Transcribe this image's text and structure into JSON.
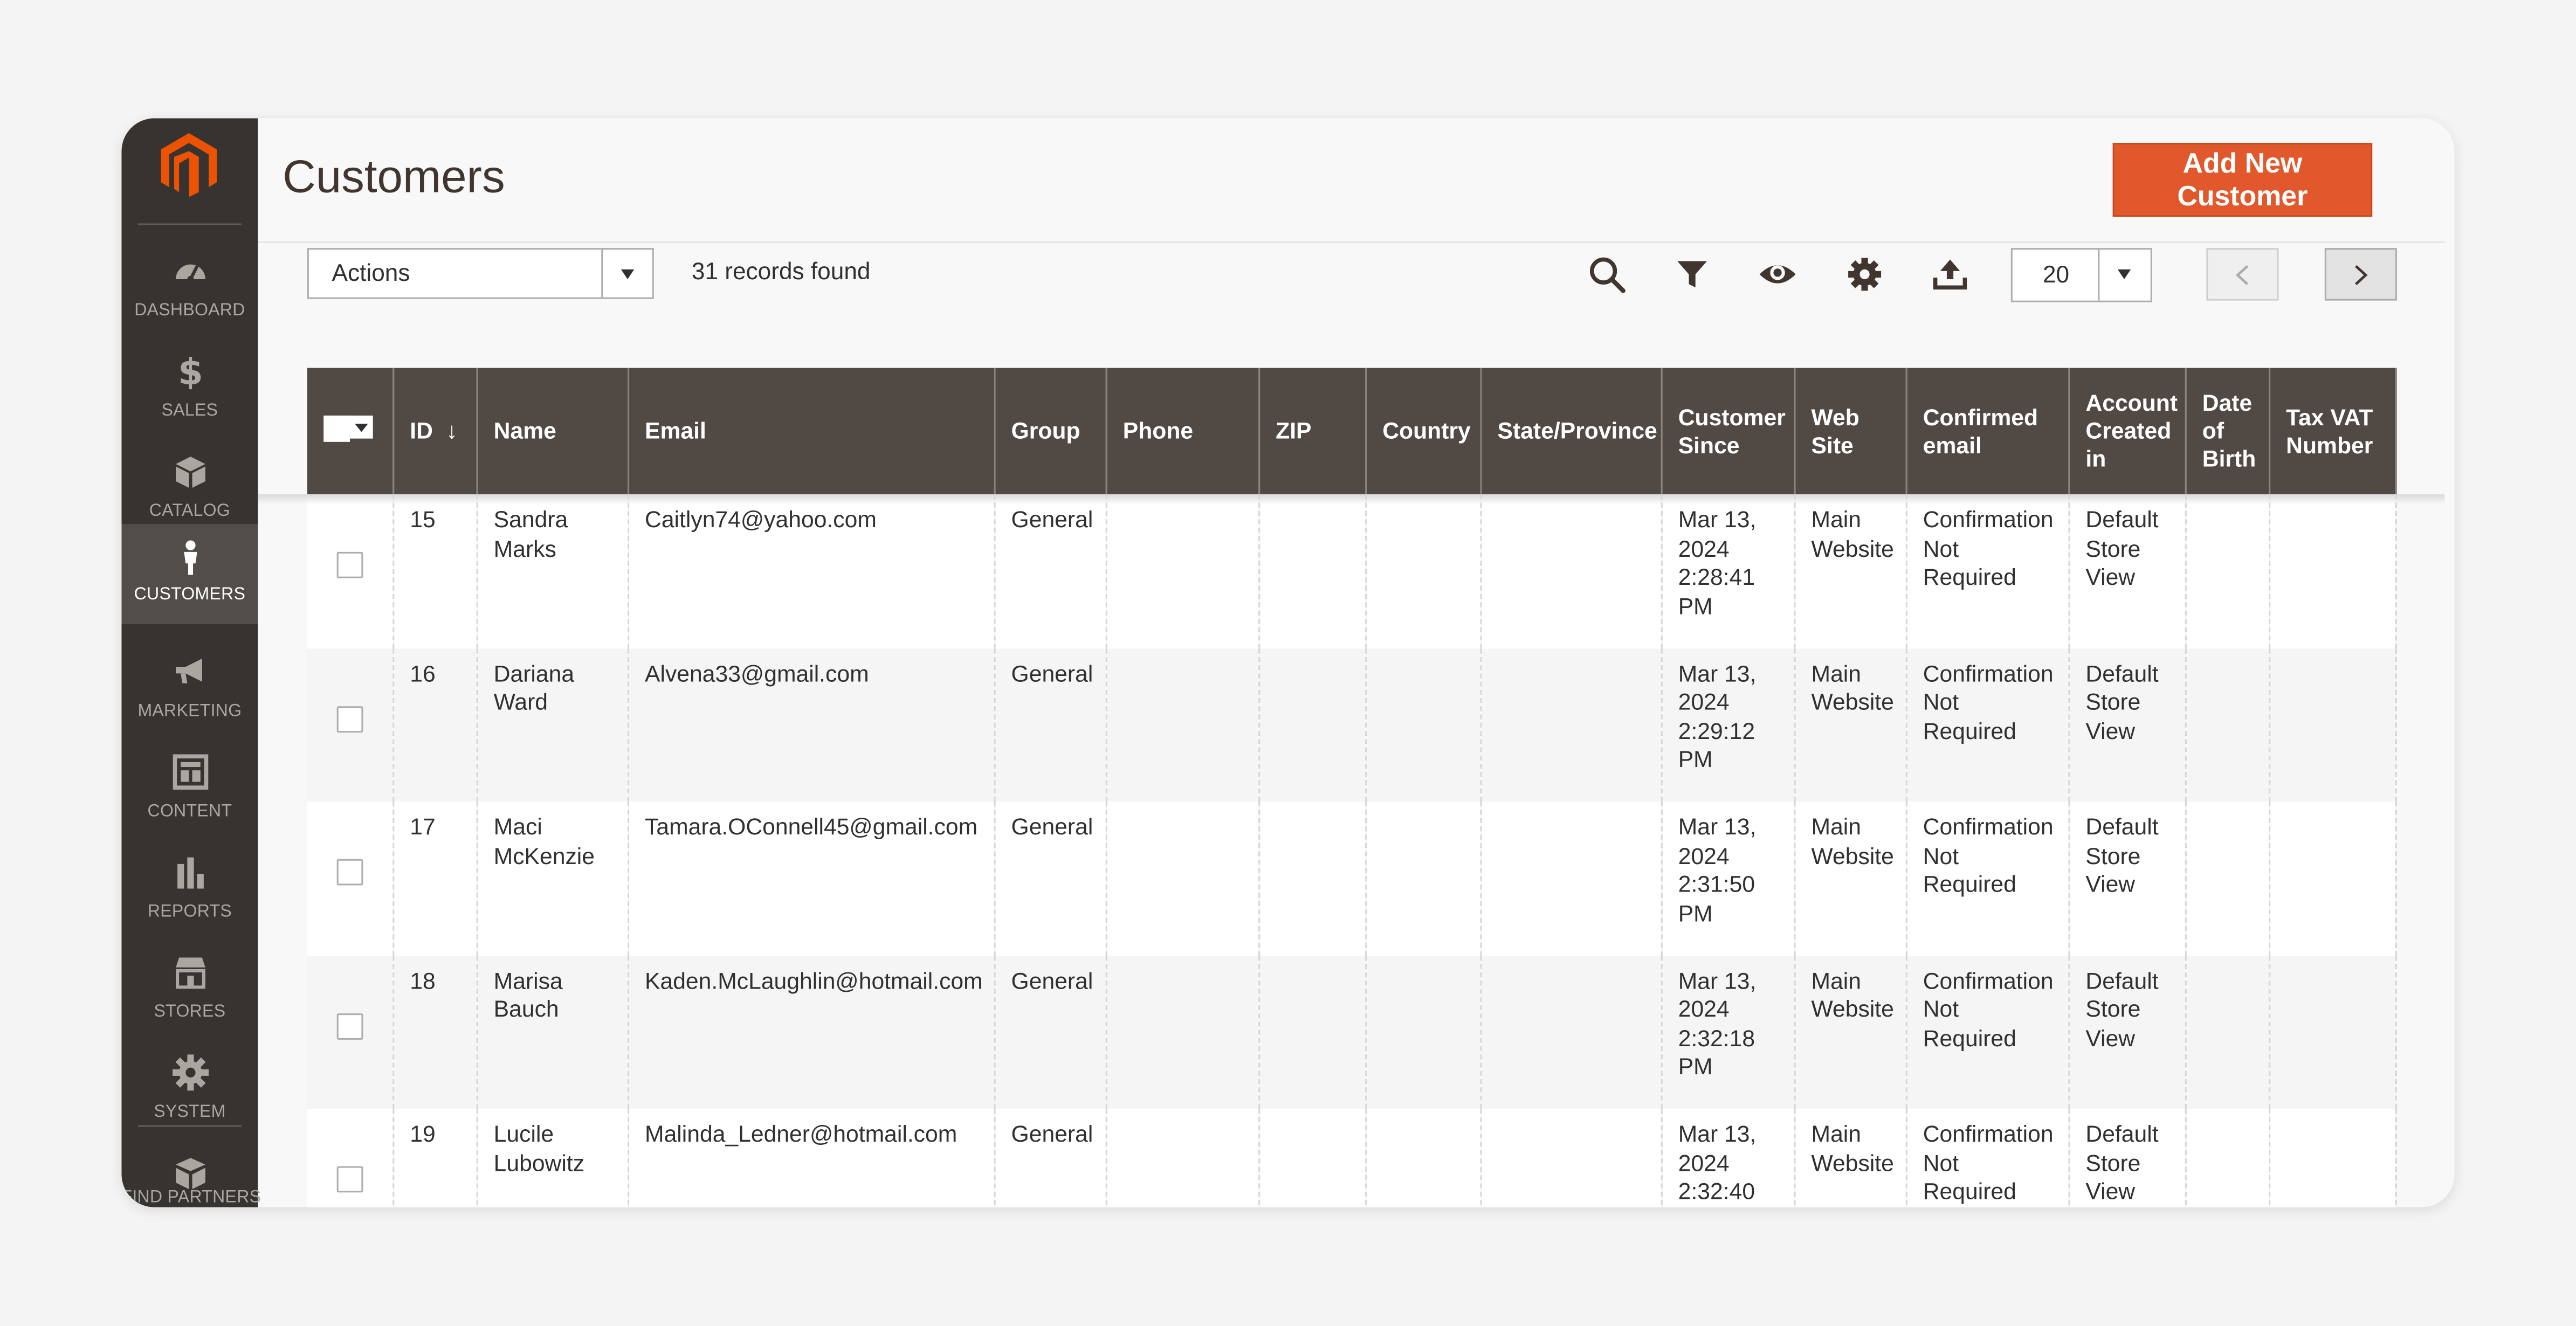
{
  "sidebar": {
    "items": [
      {
        "label": "DASHBOARD",
        "icon": "dashboard-icon"
      },
      {
        "label": "SALES",
        "icon": "dollar-icon"
      },
      {
        "label": "CATALOG",
        "icon": "cube-icon"
      },
      {
        "label": "CUSTOMERS",
        "icon": "person-icon",
        "active": true
      },
      {
        "label": "MARKETING",
        "icon": "megaphone-icon"
      },
      {
        "label": "CONTENT",
        "icon": "layout-icon"
      },
      {
        "label": "REPORTS",
        "icon": "bar-chart-icon"
      },
      {
        "label": "STORES",
        "icon": "storefront-icon"
      },
      {
        "label": "SYSTEM",
        "icon": "gear-icon"
      },
      {
        "label": "FIND PARTNERS",
        "icon": "box-icon"
      }
    ]
  },
  "header": {
    "title": "Customers",
    "add_button": "Add New Customer"
  },
  "toolbar": {
    "actions_label": "Actions",
    "records_found": "31 records found",
    "per_page": "20",
    "tools": [
      "search-icon",
      "filter-icon",
      "eye-icon",
      "gear-icon",
      "export-icon"
    ]
  },
  "grid": {
    "columns": [
      {
        "key": "id",
        "label": "ID",
        "sort": "↓"
      },
      {
        "key": "name",
        "label": "Name"
      },
      {
        "key": "email",
        "label": "Email"
      },
      {
        "key": "group",
        "label": "Group"
      },
      {
        "key": "phone",
        "label": "Phone"
      },
      {
        "key": "zip",
        "label": "ZIP"
      },
      {
        "key": "country",
        "label": "Country"
      },
      {
        "key": "state",
        "label": "State/Province"
      },
      {
        "key": "since",
        "label": "Customer Since"
      },
      {
        "key": "website",
        "label": "Web Site"
      },
      {
        "key": "confirmed",
        "label": "Confirmed email"
      },
      {
        "key": "created_in",
        "label": "Account Created in"
      },
      {
        "key": "dob",
        "label": "Date of Birth"
      },
      {
        "key": "taxvat",
        "label": "Tax VAT Number"
      }
    ],
    "rows": [
      {
        "id": "15",
        "name": "Sandra Marks",
        "email": "Caitlyn74@yahoo.com",
        "group": "General",
        "phone": "",
        "zip": "",
        "country": "",
        "state": "",
        "since": "Mar 13, 2024 2:28:41 PM",
        "website": "Main Website",
        "confirmed": "Confirmation Not Required",
        "created_in": "Default Store View",
        "dob": "",
        "taxvat": ""
      },
      {
        "id": "16",
        "name": "Dariana Ward",
        "email": "Alvena33@gmail.com",
        "group": "General",
        "phone": "",
        "zip": "",
        "country": "",
        "state": "",
        "since": "Mar 13, 2024 2:29:12 PM",
        "website": "Main Website",
        "confirmed": "Confirmation Not Required",
        "created_in": "Default Store View",
        "dob": "",
        "taxvat": ""
      },
      {
        "id": "17",
        "name": "Maci McKenzie",
        "email": "Tamara.OConnell45@gmail.com",
        "group": "General",
        "phone": "",
        "zip": "",
        "country": "",
        "state": "",
        "since": "Mar 13, 2024 2:31:50 PM",
        "website": "Main Website",
        "confirmed": "Confirmation Not Required",
        "created_in": "Default Store View",
        "dob": "",
        "taxvat": ""
      },
      {
        "id": "18",
        "name": "Marisa Bauch",
        "email": "Kaden.McLaughlin@hotmail.com",
        "group": "General",
        "phone": "",
        "zip": "",
        "country": "",
        "state": "",
        "since": "Mar 13, 2024 2:32:18 PM",
        "website": "Main Website",
        "confirmed": "Confirmation Not Required",
        "created_in": "Default Store View",
        "dob": "",
        "taxvat": ""
      },
      {
        "id": "19",
        "name": "Lucile Lubowitz",
        "email": "Malinda_Ledner@hotmail.com",
        "group": "General",
        "phone": "",
        "zip": "",
        "country": "",
        "state": "",
        "since": "Mar 13, 2024 2:32:40",
        "website": "Main Website",
        "confirmed": "Confirmation Not Required",
        "created_in": "Default Store View",
        "dob": "",
        "taxvat": ""
      }
    ]
  },
  "colors": {
    "sidebar_bg": "#373330",
    "sidebar_active": "#524d49",
    "header_bg": "#514943",
    "accent": "#e0582b",
    "logo": "#eb5202"
  }
}
